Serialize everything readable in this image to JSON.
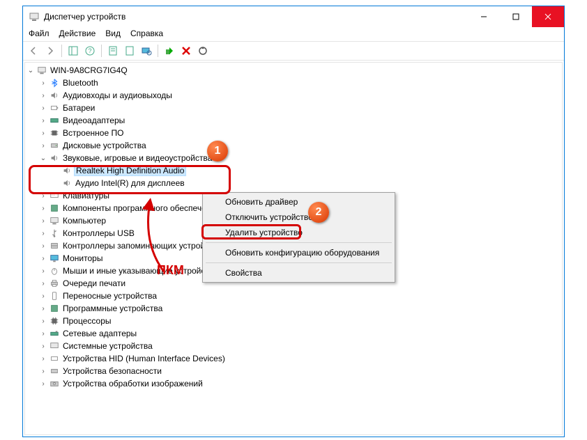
{
  "titlebar": {
    "title": "Диспетчер устройств"
  },
  "menubar": {
    "file": "Файл",
    "action": "Действие",
    "view": "Вид",
    "help": "Справка"
  },
  "tree": {
    "root": "WIN-9A8CRG7IG4Q",
    "items": [
      "Bluetooth",
      "Аудиовходы и аудиовыходы",
      "Батареи",
      "Видеоадаптеры",
      "Встроенное ПО",
      "Дисковые устройства",
      "Звуковые, игровые и видеоустройства",
      "Клавиатуры",
      "Компоненты программного обеспечения",
      "Компьютер",
      "Контроллеры USB",
      "Контроллеры запоминающих устройств",
      "Мониторы",
      "Мыши и иные указывающие устройства",
      "Очереди печати",
      "Переносные устройства",
      "Программные устройства",
      "Процессоры",
      "Сетевые адаптеры",
      "Системные устройства",
      "Устройства HID (Human Interface Devices)",
      "Устройства безопасности",
      "Устройства обработки изображений"
    ],
    "audio_children": [
      "Realtek High Definition Audio",
      "Аудио Intel(R) для дисплеев"
    ]
  },
  "context_menu": {
    "update_driver": "Обновить драйвер",
    "disable_device": "Отключить устройство",
    "uninstall_device": "Удалить устройство",
    "scan_hardware": "Обновить конфигурацию оборудования",
    "properties": "Свойства"
  },
  "annotations": {
    "badge1": "1",
    "badge2": "2",
    "pkm": "ПКМ"
  }
}
